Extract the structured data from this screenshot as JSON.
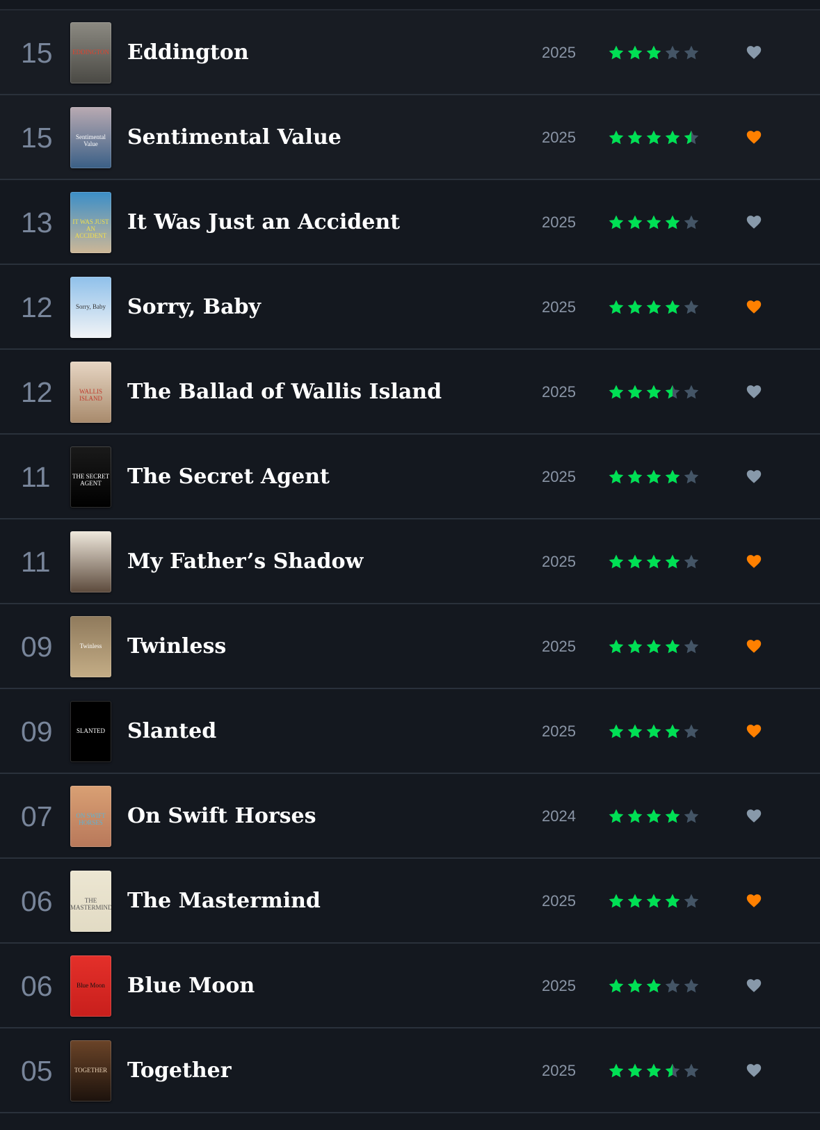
{
  "colors": {
    "background": "#14181f",
    "star_filled": "#00e054",
    "star_empty": "#445566",
    "heart_liked": "#ff8000",
    "heart_unliked": "#8899aa",
    "rank": "#78859a",
    "year": "#8a95a6"
  },
  "films": [
    {
      "rank": "15",
      "title": "Eddington",
      "year": "2025",
      "rating": 3,
      "liked": false,
      "poster_colors": [
        "#8c8a82",
        "#4a4944"
      ],
      "poster_text": "EDDINGTON",
      "poster_text_color": "#e2412c"
    },
    {
      "rank": "15",
      "title": "Sentimental Value",
      "year": "2025",
      "rating": 4.5,
      "liked": true,
      "poster_colors": [
        "#b9aab2",
        "#3a5f86"
      ],
      "poster_text": "Sentimental Value",
      "poster_text_color": "#ffffff"
    },
    {
      "rank": "13",
      "title": "It Was Just an Accident",
      "year": "2025",
      "rating": 4,
      "liked": false,
      "poster_colors": [
        "#3b8ec8",
        "#cdb796"
      ],
      "poster_text": "IT WAS JUST AN ACCIDENT",
      "poster_text_color": "#f4e04a"
    },
    {
      "rank": "12",
      "title": "Sorry, Baby",
      "year": "2025",
      "rating": 4,
      "liked": true,
      "poster_colors": [
        "#8fc0ea",
        "#f2f4f6"
      ],
      "poster_text": "Sorry, Baby",
      "poster_text_color": "#333333"
    },
    {
      "rank": "12",
      "title": "The Ballad of Wallis Island",
      "year": "2025",
      "rating": 3.5,
      "liked": false,
      "poster_colors": [
        "#e7d6c4",
        "#a88a6c"
      ],
      "poster_text": "WALLIS ISLAND",
      "poster_text_color": "#c0392b"
    },
    {
      "rank": "11",
      "title": "The Secret Agent",
      "year": "2025",
      "rating": 4,
      "liked": false,
      "poster_colors": [
        "#1a1a1a",
        "#000000"
      ],
      "poster_text": "THE SECRET AGENT",
      "poster_text_color": "#ffffff"
    },
    {
      "rank": "11",
      "title": "My Father’s Shadow",
      "year": "2025",
      "rating": 4,
      "liked": true,
      "poster_colors": [
        "#efe8dc",
        "#5c4a3c"
      ],
      "poster_text": "",
      "poster_text_color": "#ffffff"
    },
    {
      "rank": "09",
      "title": "Twinless",
      "year": "2025",
      "rating": 4,
      "liked": true,
      "poster_colors": [
        "#8f7a5c",
        "#c4ad86"
      ],
      "poster_text": "Twinless",
      "poster_text_color": "#ffffff"
    },
    {
      "rank": "09",
      "title": "Slanted",
      "year": "2025",
      "rating": 4,
      "liked": true,
      "poster_colors": [
        "#000000",
        "#000000"
      ],
      "poster_text": "SLANTED",
      "poster_text_color": "#ffffff"
    },
    {
      "rank": "07",
      "title": "On Swift Horses",
      "year": "2024",
      "rating": 4,
      "liked": false,
      "poster_colors": [
        "#d9a074",
        "#b8785a"
      ],
      "poster_text": "ON SWIFT HORSES",
      "poster_text_color": "#5ab4d6"
    },
    {
      "rank": "06",
      "title": "The Mastermind",
      "year": "2025",
      "rating": 4,
      "liked": true,
      "poster_colors": [
        "#ece6d2",
        "#e2dbc4"
      ],
      "poster_text": "THE MASTERMIND",
      "poster_text_color": "#555555"
    },
    {
      "rank": "06",
      "title": "Blue Moon",
      "year": "2025",
      "rating": 3,
      "liked": false,
      "poster_colors": [
        "#e4302a",
        "#c81f1c"
      ],
      "poster_text": "Blue Moon",
      "poster_text_color": "#111111"
    },
    {
      "rank": "05",
      "title": "Together",
      "year": "2025",
      "rating": 3.5,
      "liked": false,
      "poster_colors": [
        "#6b4428",
        "#1c120c"
      ],
      "poster_text": "TOGETHER",
      "poster_text_color": "#e8d2b6"
    }
  ]
}
